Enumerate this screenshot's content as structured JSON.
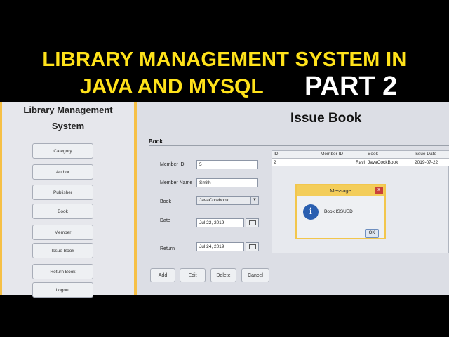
{
  "banner": {
    "line1": "LIBRARY MANAGEMENT SYSTEM IN",
    "line2": "JAVA AND MYSQL",
    "line3": "PART 2"
  },
  "sidebar": {
    "title_line1": "Library Management",
    "title_line2": "System",
    "items": [
      {
        "label": "Category"
      },
      {
        "label": "Author"
      },
      {
        "label": "Publisher"
      },
      {
        "label": "Book"
      },
      {
        "label": "Member"
      },
      {
        "label": "Issue Book"
      },
      {
        "label": "Return Book"
      },
      {
        "label": "Logout"
      }
    ]
  },
  "main": {
    "title": "Issue Book",
    "section": "Book",
    "form": {
      "member_id_label": "Member ID",
      "member_id_value": "5",
      "member_name_label": "Member Name",
      "member_name_value": "Smith",
      "book_label": "Book",
      "book_value": "JavaCorebook",
      "date_label": "Date",
      "date_value": "Jul 22, 2019",
      "return_label": "Return",
      "return_value": "Jul 24, 2019"
    },
    "table": {
      "columns": [
        "ID",
        "Member ID",
        "Book",
        "Issue Date"
      ],
      "rows": [
        [
          "2",
          "Ravi",
          "JavaCockBook",
          "2019-07-22"
        ]
      ]
    },
    "buttons": {
      "add": "Add",
      "edit": "Edit",
      "delete": "Delete",
      "cancel": "Cancel"
    }
  },
  "dialog": {
    "title": "Message",
    "message": "Book ISSUED",
    "ok": "OK",
    "close": "x",
    "icon": "info-icon"
  },
  "colors": {
    "banner_yellow": "#ffe21a",
    "sidebar_border": "#f6c046",
    "dialog_title": "#f3cd5a"
  }
}
